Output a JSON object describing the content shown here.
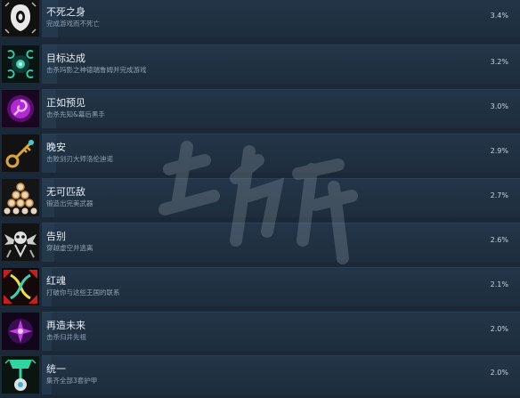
{
  "achievements": [
    {
      "name": "不死之身",
      "desc": "完成游戏而不死亡",
      "pct": "3.4%",
      "fill": 0.034,
      "icon": "ghost-mask-icon"
    },
    {
      "name": "目标达成",
      "desc": "击杀玛影之神德瑞鲁姆并完成游戏",
      "pct": "3.2%",
      "fill": 0.032,
      "icon": "glowing-orb-icon"
    },
    {
      "name": "正如预见",
      "desc": "击杀先知&幕后黑手",
      "pct": "3.0%",
      "fill": 0.03,
      "icon": "magenta-spiral-icon"
    },
    {
      "name": "晚安",
      "desc": "击败剑刃大师洛伦迪诺",
      "pct": "2.9%",
      "fill": 0.029,
      "icon": "golden-key-icon"
    },
    {
      "name": "无可匹敌",
      "desc": "锻造出完美武器",
      "pct": "2.7%",
      "fill": 0.027,
      "icon": "triangle-orbs-icon"
    },
    {
      "name": "告别",
      "desc": "穿越虚空并逃离",
      "pct": "2.6%",
      "fill": 0.026,
      "icon": "winged-skull-icon"
    },
    {
      "name": "红魂",
      "desc": "打破你与这些王国的联系",
      "pct": "2.1%",
      "fill": 0.021,
      "icon": "twisted-strands-icon"
    },
    {
      "name": "再造未来",
      "desc": "击杀归井先祖",
      "pct": "2.0%",
      "fill": 0.02,
      "icon": "purple-flower-icon"
    },
    {
      "name": "统一",
      "desc": "集齐全部3套护甲",
      "pct": "2.0%",
      "fill": 0.02,
      "icon": "green-shield-icon"
    }
  ],
  "colors": {
    "bg": "#1b2838",
    "row": "#233547",
    "text": "#e6eef5",
    "subtext": "#8fa2b3"
  }
}
